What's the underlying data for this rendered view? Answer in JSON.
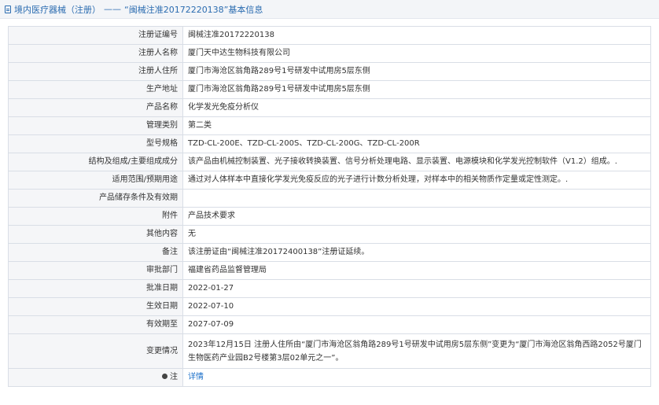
{
  "header": {
    "category": "境内医疗器械（注册）",
    "separator": "——",
    "reg_title": "“闽械注准20172220138”基本信息"
  },
  "rows": [
    {
      "label": "注册证编号",
      "value": "闽械注准20172220138"
    },
    {
      "label": "注册人名称",
      "value": "厦门天中达生物科技有限公司"
    },
    {
      "label": "注册人住所",
      "value": "厦门市海沧区翁角路289号1号研发中试用房5层东侧"
    },
    {
      "label": "生产地址",
      "value": "厦门市海沧区翁角路289号1号研发中试用房5层东侧"
    },
    {
      "label": "产品名称",
      "value": "化学发光免疫分析仪"
    },
    {
      "label": "管理类别",
      "value": "第二类"
    },
    {
      "label": "型号规格",
      "value": "TZD-CL-200E、TZD-CL-200S、TZD-CL-200G、TZD-CL-200R"
    },
    {
      "label": "结构及组成/主要组成成分",
      "value": "该产品由机械控制装置、光子接收转换装置、信号分析处理电路、显示装置、电源模块和化学发光控制软件（V1.2）组成。."
    },
    {
      "label": "适用范围/预期用途",
      "value": "通过对人体样本中直接化学发光免疫反应的光子进行计数分析处理，对样本中的相关物质作定量或定性测定。."
    },
    {
      "label": "产品储存条件及有效期",
      "value": ""
    },
    {
      "label": "附件",
      "value": "产品技术要求"
    },
    {
      "label": "其他内容",
      "value": "无"
    },
    {
      "label": "备注",
      "value": "该注册证由“闽械注准20172400138”注册证延续。"
    },
    {
      "label": "审批部门",
      "value": "福建省药品监督管理局"
    },
    {
      "label": "批准日期",
      "value": "2022-01-27"
    },
    {
      "label": "生效日期",
      "value": "2022-07-10"
    },
    {
      "label": "有效期至",
      "value": "2027-07-09"
    },
    {
      "label": "变更情况",
      "value": "2023年12月15日 注册人住所由“厦门市海沧区翁角路289号1号研发中试用房5层东侧”变更为“厦门市海沧区翁角西路2052号厦门生物医药产业园B2号楼第3层02单元之一”。"
    }
  ],
  "remark": {
    "label": "注",
    "link_text": "详情"
  }
}
